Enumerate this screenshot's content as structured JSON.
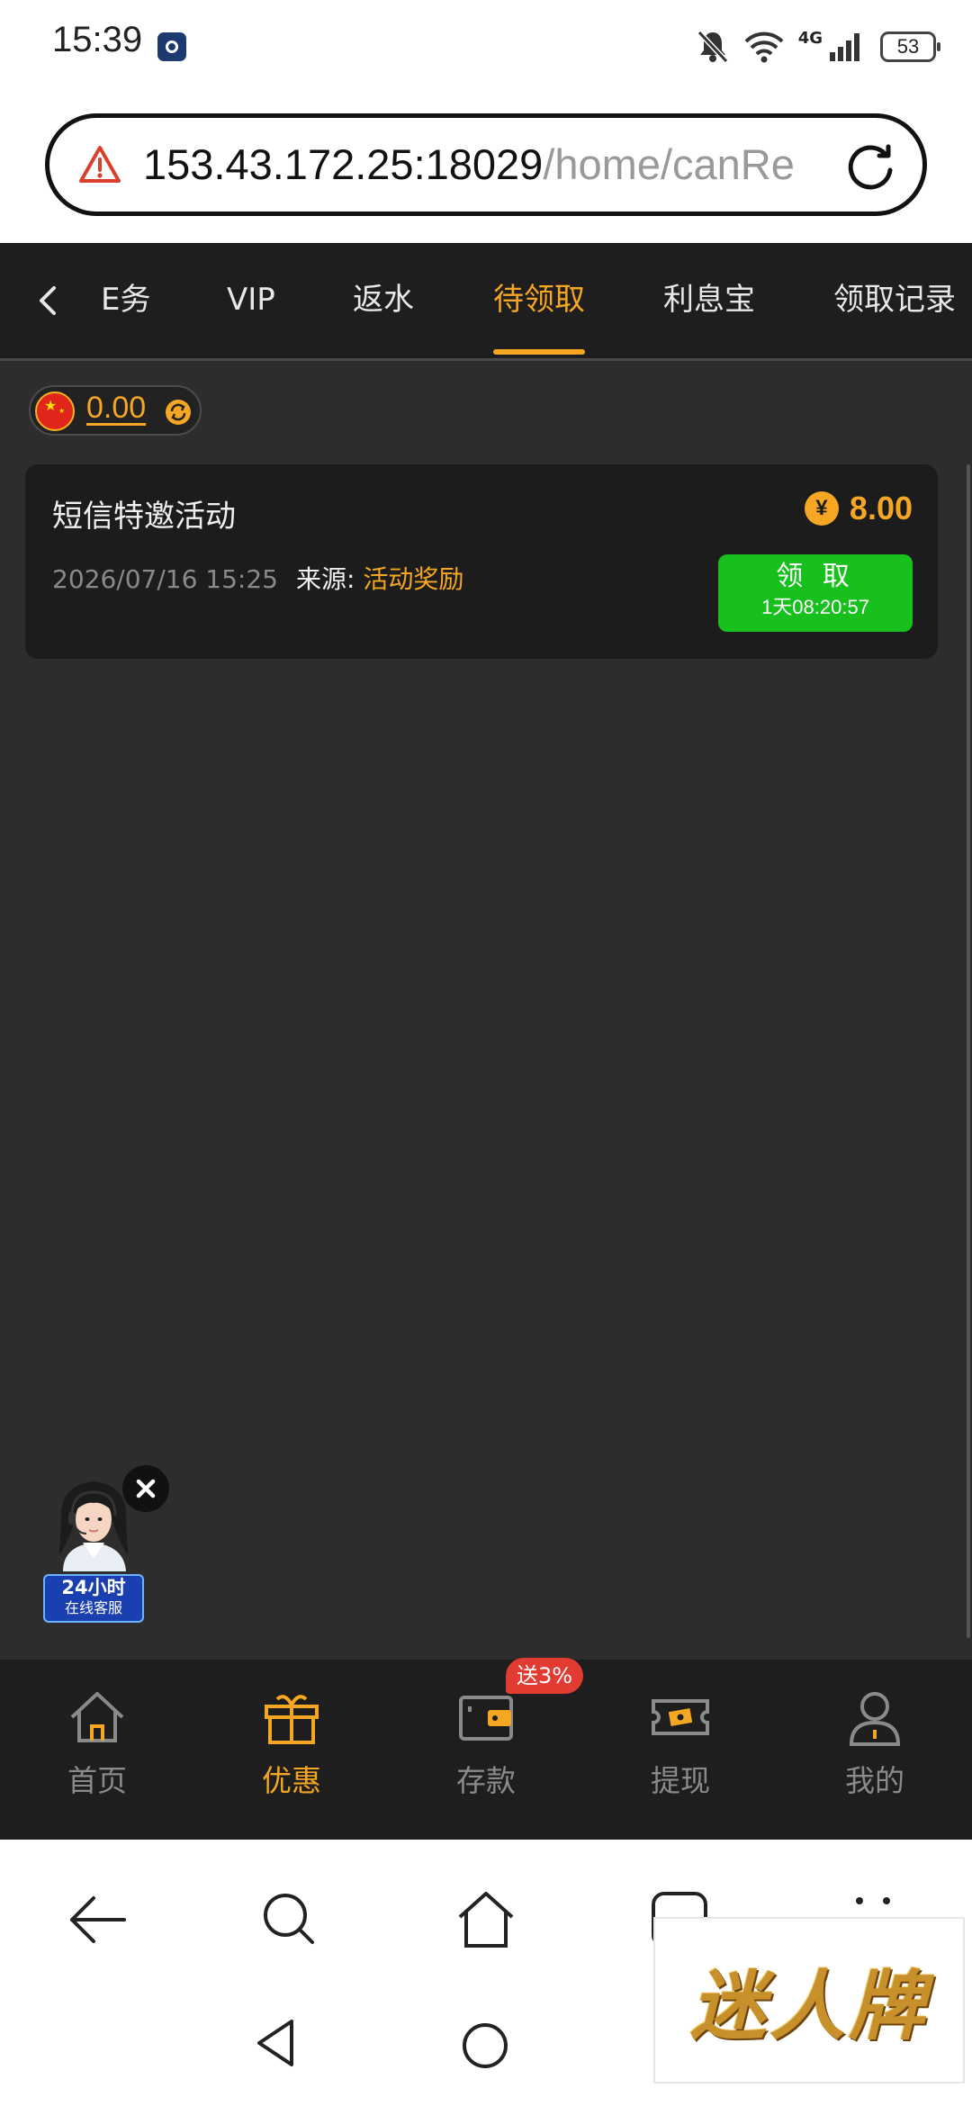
{
  "status_bar": {
    "time": "15:39",
    "network": "4G",
    "battery": "53",
    "icons": [
      "app-icon",
      "mute-icon",
      "wifi-icon",
      "signal-icon",
      "battery-icon"
    ]
  },
  "address_bar": {
    "host": "153.43.172.25:18029",
    "path": "/home/canRe",
    "icons": [
      "warning-icon",
      "reload-icon"
    ]
  },
  "tabs": {
    "items": [
      {
        "label": "E务"
      },
      {
        "label": "VIP"
      },
      {
        "label": "返水"
      },
      {
        "label": "待领取",
        "active": true
      },
      {
        "label": "利息宝"
      },
      {
        "label": "领取记录"
      }
    ]
  },
  "balance": {
    "value": "0.00"
  },
  "reward_card": {
    "title": "短信特邀活动",
    "amount": "8.00",
    "currency_symbol": "¥",
    "date": "2026/07/16 15:25",
    "source_label": "来源:",
    "source_value": "活动奖励",
    "claim_label": "领 取",
    "countdown": "1天08:20:57"
  },
  "support_widget": {
    "line1": "24小时",
    "line2": "在线客服"
  },
  "bottom_nav": {
    "items": [
      {
        "label": "首页",
        "icon": "home-icon"
      },
      {
        "label": "优惠",
        "icon": "gift-icon",
        "active": true
      },
      {
        "label": "存款",
        "icon": "wallet-icon"
      },
      {
        "label": "提现",
        "icon": "cash-icon"
      },
      {
        "label": "我的",
        "icon": "user-icon"
      }
    ],
    "promo_badge": "送3%"
  },
  "watermark": {
    "text": "迷人牌"
  },
  "colors": {
    "accent": "#f5a623",
    "claim_green": "#18c01e",
    "background": "#2d2d2d",
    "card": "#1c1c1c",
    "promo_red": "#e23b32"
  }
}
